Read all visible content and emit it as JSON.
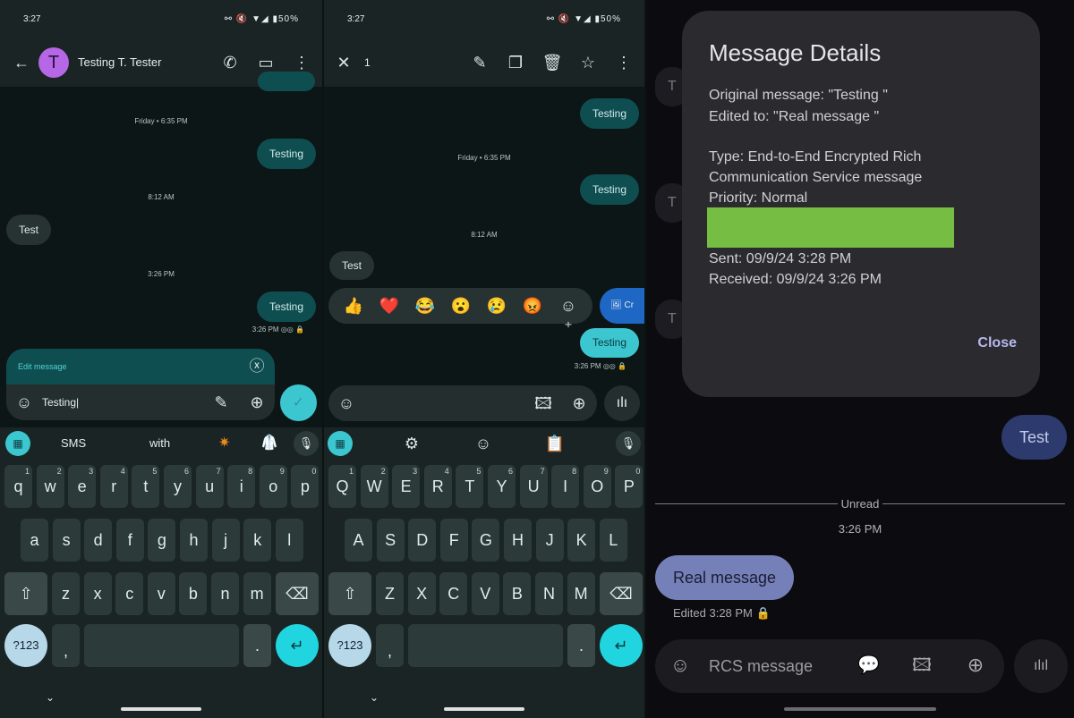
{
  "status": {
    "time": "3:27",
    "icons": "link-icon mute-icon wifi-icon signal-icon battery-icon",
    "battery": "50%"
  },
  "left": {
    "contact_initial": "T",
    "contact_name": "Testing T. Tester",
    "messages": [
      {
        "type": "stamp",
        "text": "Friday • 6:35 PM"
      },
      {
        "type": "out",
        "text": "Testing"
      },
      {
        "type": "stamp",
        "text": "8:12 AM"
      },
      {
        "type": "in",
        "text": "Test"
      },
      {
        "type": "stamp",
        "text": "3:26 PM"
      },
      {
        "type": "out",
        "text": "Testing"
      }
    ],
    "meta": "3:26 PM",
    "edit_label": "Edit message",
    "input_value": "Testing",
    "suggestions": [
      "SMS",
      "with"
    ],
    "accent": "#3cc7d0"
  },
  "middle": {
    "selected_count": "1",
    "messages": [
      {
        "type": "out",
        "text": "Testing"
      },
      {
        "type": "stamp",
        "text": "Friday • 6:35 PM"
      },
      {
        "type": "out",
        "text": "Testing"
      },
      {
        "type": "stamp",
        "text": "8:12 AM"
      },
      {
        "type": "in",
        "text": "Test"
      },
      {
        "type": "sel",
        "text": "Testing"
      }
    ],
    "reactions": [
      "👍",
      "❤️",
      "😂",
      "😮",
      "😢",
      "😡"
    ],
    "create_label": "Cr",
    "meta": "3:26 PM"
  },
  "keyboard_left": {
    "rows": [
      [
        "q",
        "w",
        "e",
        "r",
        "t",
        "y",
        "u",
        "i",
        "o",
        "p"
      ],
      [
        "a",
        "s",
        "d",
        "f",
        "g",
        "h",
        "j",
        "k",
        "l"
      ],
      [
        "z",
        "x",
        "c",
        "v",
        "b",
        "n",
        "m"
      ]
    ],
    "numbers": [
      "1",
      "2",
      "3",
      "4",
      "5",
      "6",
      "7",
      "8",
      "9",
      "0"
    ],
    "sym": "?123",
    "comma": ",",
    "period": "."
  },
  "keyboard_mid": {
    "rows": [
      [
        "Q",
        "W",
        "E",
        "R",
        "T",
        "Y",
        "U",
        "I",
        "O",
        "P"
      ],
      [
        "A",
        "S",
        "D",
        "F",
        "G",
        "H",
        "J",
        "K",
        "L"
      ],
      [
        "Z",
        "X",
        "C",
        "V",
        "B",
        "N",
        "M"
      ]
    ],
    "numbers": [
      "1",
      "2",
      "3",
      "4",
      "5",
      "6",
      "7",
      "8",
      "9",
      "0"
    ],
    "sym": "?123",
    "comma": ",",
    "period": "."
  },
  "right": {
    "bg_bubbles": [
      "T",
      "T",
      "T"
    ],
    "dialog": {
      "title": "Message Details",
      "original": "Original message: \"Testing \"",
      "edited": "Edited to: \"Real message \"",
      "type1": "Type: End-to-End Encrypted Rich",
      "type2": "Communication Service message",
      "priority": "Priority: Normal",
      "redaction_color": "#76bd44",
      "sent": "Sent: 09/9/24 3:28 PM",
      "received": "Received: 09/9/24 3:26 PM",
      "close": "Close"
    },
    "out_message": "Test",
    "unread": "Unread",
    "stamp": "3:26 PM",
    "in_message": "Real message",
    "edited_meta": "Edited  3:28 PM",
    "placeholder": "RCS message"
  }
}
